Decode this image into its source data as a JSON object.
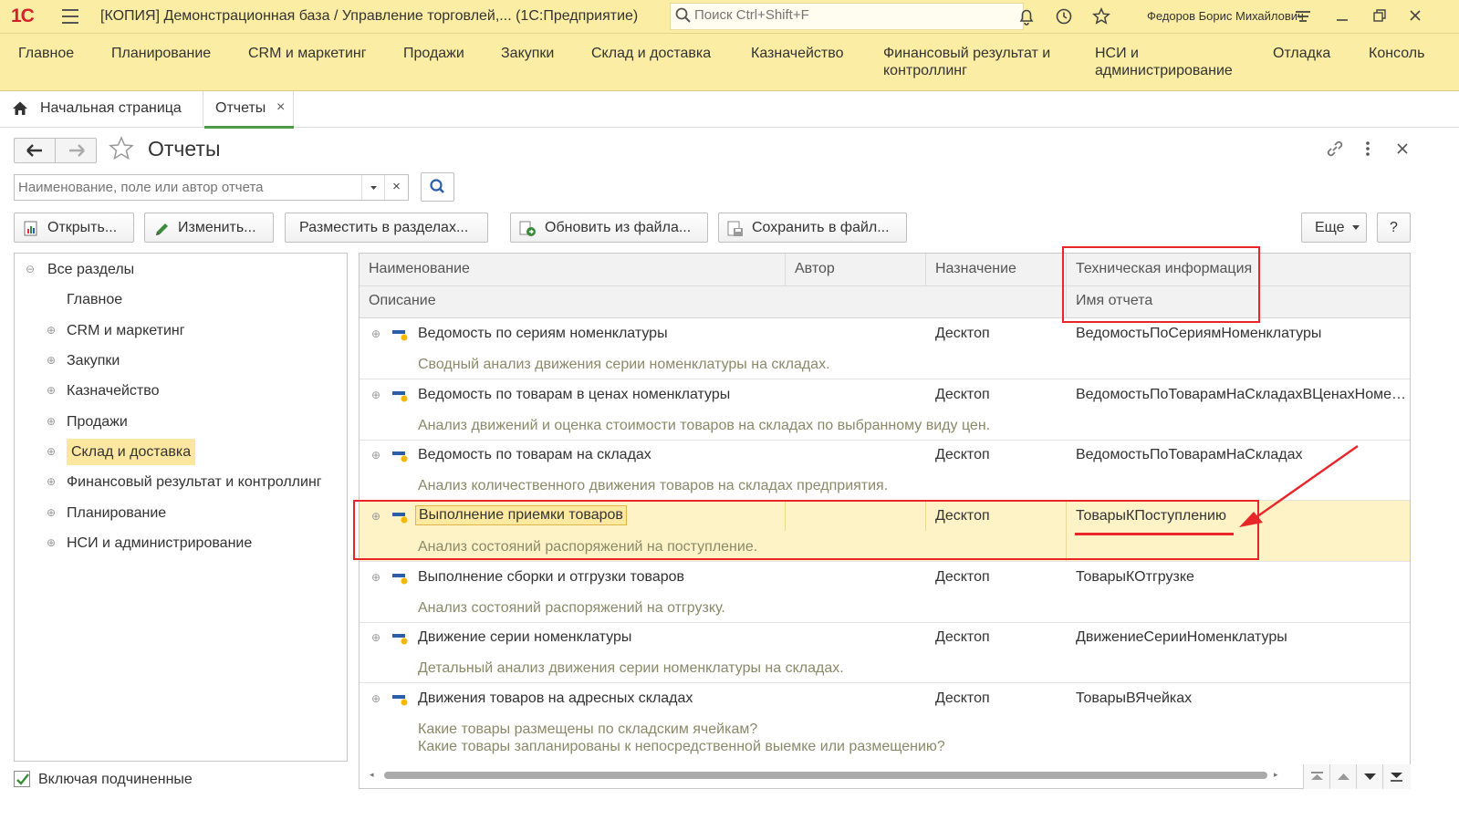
{
  "titlebar": {
    "logo": "1С",
    "title": "[КОПИЯ] Демонстрационная база / Управление торговлей,... (1С:Предприятие)",
    "search_placeholder": "Поиск Ctrl+Shift+F",
    "user": "Федоров Борис Михайлович"
  },
  "sections": [
    {
      "label": "Главное"
    },
    {
      "label": "Планирование"
    },
    {
      "label": "CRM и маркетинг"
    },
    {
      "label": "Продажи"
    },
    {
      "label": "Закупки"
    },
    {
      "label": "Склад и доставка"
    },
    {
      "label": "Казначейство"
    },
    {
      "label": "Финансовый результат и контроллинг"
    },
    {
      "label": "НСИ и администрирование"
    },
    {
      "label": "Отладка"
    },
    {
      "label": "Консоль"
    }
  ],
  "tabs": {
    "home": "Начальная страница",
    "reports": "Отчеты",
    "close": "×"
  },
  "form": {
    "title": "Отчеты",
    "search_placeholder": "Наименование, поле или автор отчета",
    "clear": "×"
  },
  "toolbar": {
    "open": "Открыть...",
    "edit": "Изменить...",
    "place": "Разместить в разделах...",
    "update": "Обновить из файла...",
    "save": "Сохранить в файл...",
    "more": "Еще",
    "help": "?"
  },
  "tree": {
    "root": "Все разделы",
    "items": [
      {
        "label": "Главное",
        "expandable": false
      },
      {
        "label": "CRM и маркетинг",
        "expandable": true
      },
      {
        "label": "Закупки",
        "expandable": true
      },
      {
        "label": "Казначейство",
        "expandable": true
      },
      {
        "label": "Продажи",
        "expandable": true
      },
      {
        "label": "Склад и доставка",
        "expandable": true,
        "selected": true
      },
      {
        "label": "Финансовый результат и контроллинг",
        "expandable": true
      },
      {
        "label": "Планирование",
        "expandable": true
      },
      {
        "label": "НСИ и администрирование",
        "expandable": true
      }
    ]
  },
  "include_sub": {
    "label": "Включая подчиненные",
    "checked": true
  },
  "grid": {
    "columns": {
      "name": "Наименование",
      "author": "Автор",
      "purpose": "Назначение",
      "tech": "Техническая информация",
      "description": "Описание",
      "report_name": "Имя отчета"
    },
    "rows": [
      {
        "name": "Ведомость по сериям номенклатуры",
        "desc": "Сводный анализ движения серии номенклатуры на складах.",
        "purpose": "Десктоп",
        "tech": "ВедомостьПоСериямНоменклатуры"
      },
      {
        "name": "Ведомость по товарам в ценах номенклатуры",
        "desc": "Анализ движений и оценка стоимости товаров на складах по выбранному виду цен.",
        "purpose": "Десктоп",
        "tech": "ВедомостьПоТоварамНаСкладахВЦенахНоменклатуры"
      },
      {
        "name": "Ведомость по товарам на складах",
        "desc": "Анализ количественного движения товаров на складах предприятия.",
        "purpose": "Десктоп",
        "tech": "ВедомостьПоТоварамНаСкладах"
      },
      {
        "name": "Выполнение приемки товаров",
        "desc": "Анализ состояний распоряжений на поступление.",
        "purpose": "Десктоп",
        "tech": "ТоварыКПоступлению",
        "selected": true
      },
      {
        "name": "Выполнение сборки и отгрузки товаров",
        "desc": "Анализ состояний распоряжений на отгрузку.",
        "purpose": "Десктоп",
        "tech": "ТоварыКОтгрузке"
      },
      {
        "name": "Движение серии номенклатуры",
        "desc": "Детальный анализ движения серии номенклатуры на складах.",
        "purpose": "Десктоп",
        "tech": "ДвижениеСерииНоменклатуры"
      },
      {
        "name": "Движения товаров на адресных складах",
        "desc": "Какие товары размещены по складским ячейкам?",
        "desc2": "Какие товары запланированы к непосредственной выемке или размещению?",
        "purpose": "Десктоп",
        "tech": "ТоварыВЯчейках"
      }
    ]
  },
  "colors": {
    "brand_yellow": "#fbeda3",
    "selection": "#fdf3c6",
    "annotation_red": "#e8262a",
    "accent_green": "#4a9b4a"
  }
}
